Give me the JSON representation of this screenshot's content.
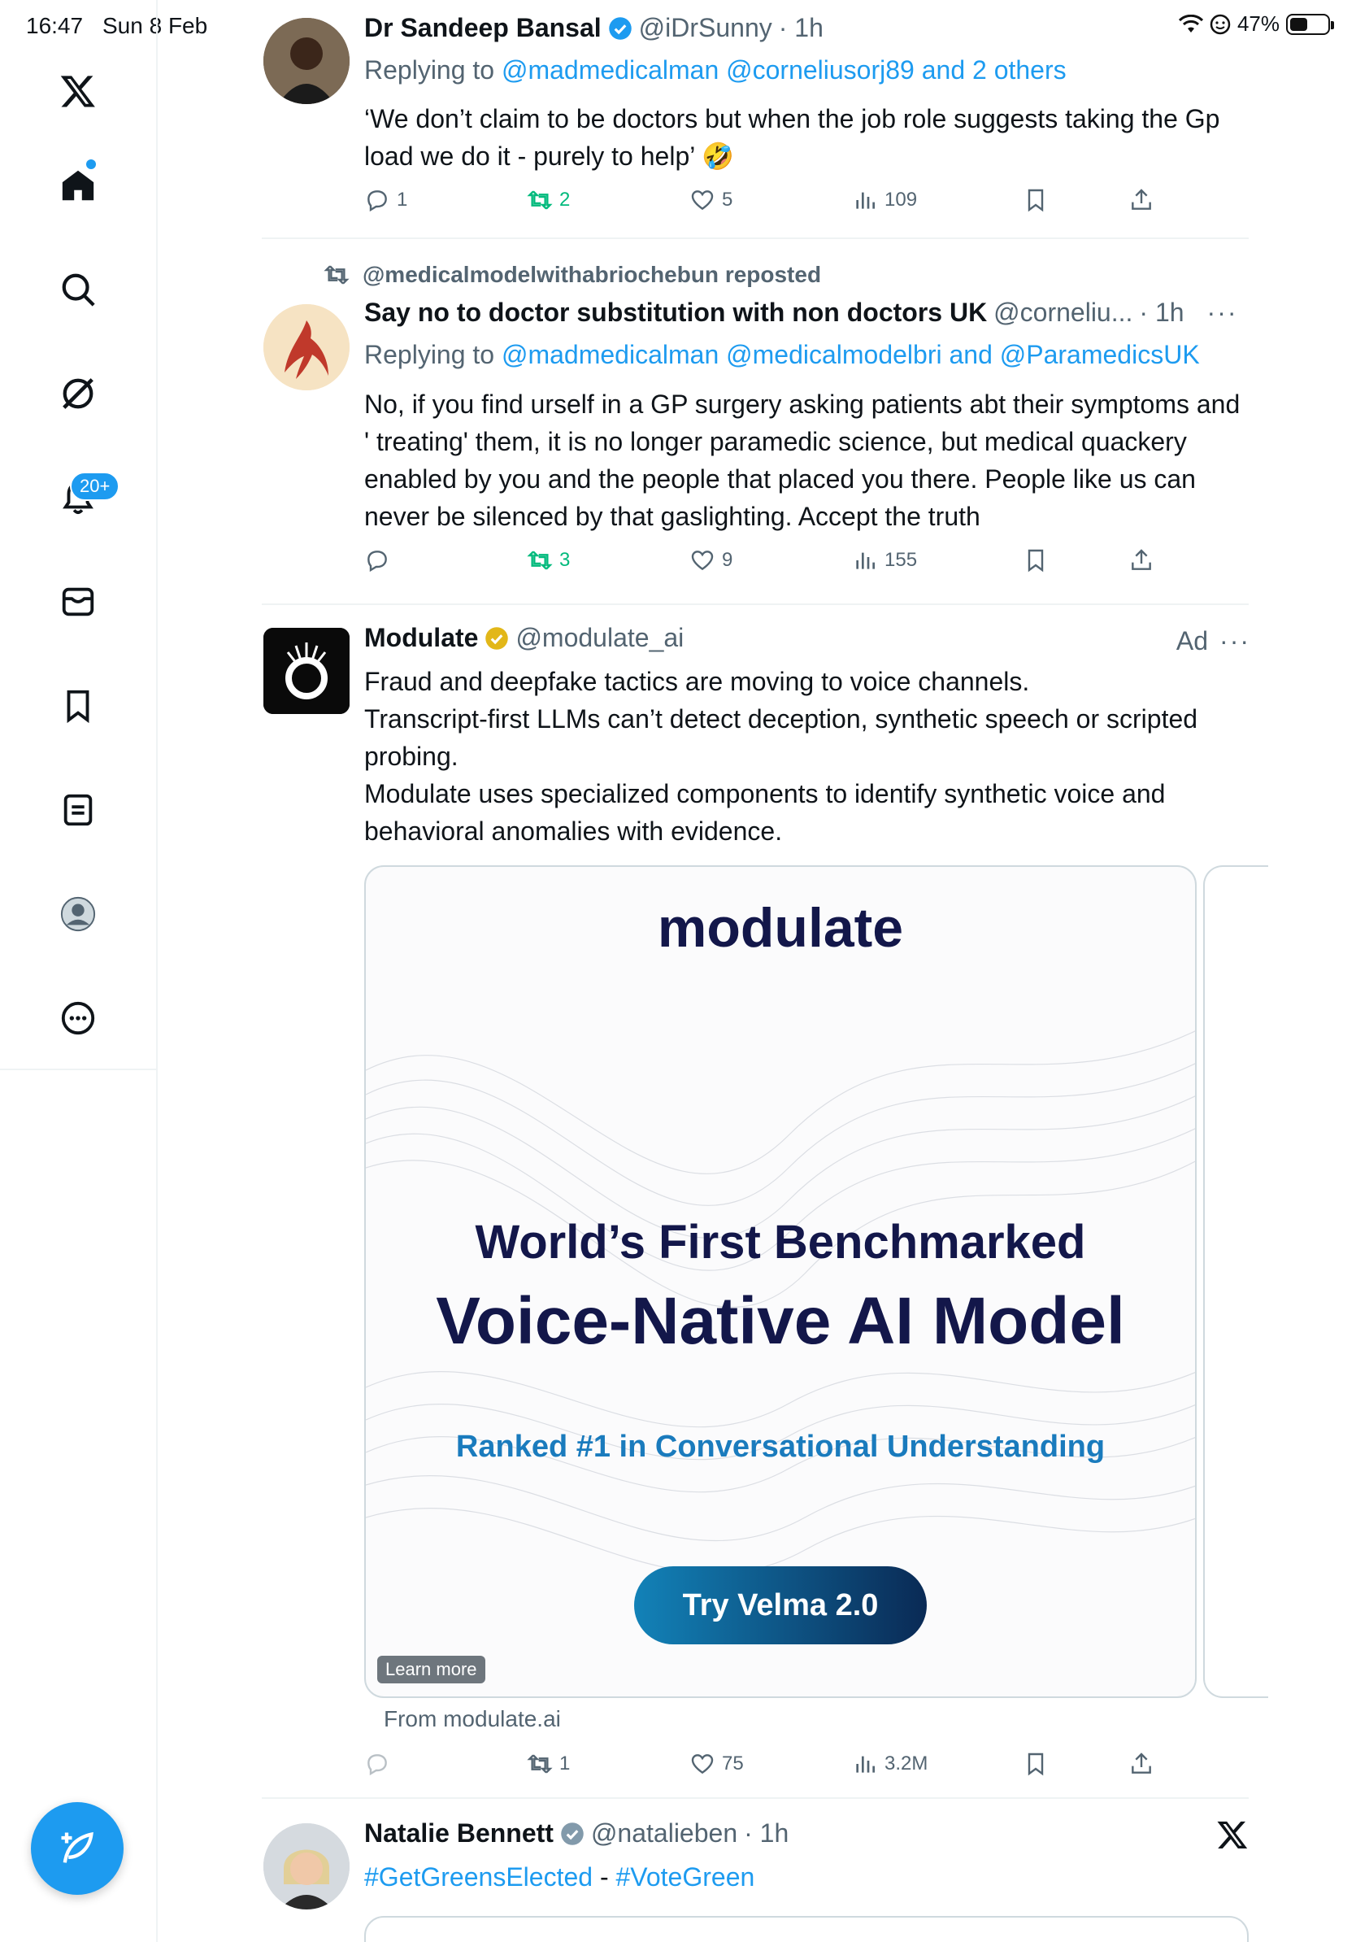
{
  "status_bar": {
    "time": "16:47",
    "date": "Sun 8 Feb",
    "battery": "47%",
    "battery_level": 0.47
  },
  "sidebar": {
    "notifications_badge": "20+",
    "accent": "#1d9bf0"
  },
  "tweets": [
    {
      "name": "Dr Sandeep Bansal",
      "handle": "@iDrSunny",
      "time": "· 1h",
      "replying_prefix": "Replying to",
      "replying_mentions": "@madmedicalman @corneliusorj89 and 2 others",
      "text": "‘We don’t claim to be doctors but when the job role suggests taking the Gp load we do it - purely to help’ 🤣",
      "replies": "1",
      "reposts": "2",
      "likes": "5",
      "views": "109"
    },
    {
      "reposted_by": "@medicalmodelwithabriochebun reposted",
      "name": "Say no to doctor substitution with non doctors UK",
      "handle": "@corneliu...",
      "time": "· 1h",
      "more": "···",
      "replying_prefix": "Replying to",
      "replying_mentions": "@madmedicalman @medicalmodelbri and @ParamedicsUK",
      "text": "No, if you find urself in a GP surgery asking patients abt their symptoms and ' treating' them, it is no longer paramedic science, but medical quackery enabled by you and the people that placed you there. People like us can never be silenced by that gaslighting. Accept the truth",
      "replies": "",
      "reposts": "3",
      "likes": "9",
      "views": "155"
    }
  ],
  "ad": {
    "name": "Modulate",
    "handle": "@modulate_ai",
    "label": "Ad",
    "more": "···",
    "text_lines": [
      "Fraud and deepfake tactics are moving to voice channels.",
      "Transcript-first LLMs can’t detect deception, synthetic speech or scripted probing.",
      "Modulate uses specialized components to identify synthetic voice and behavioral anomalies with evidence."
    ],
    "card": {
      "logo": "modulate",
      "headline": "World’s First Benchmarked",
      "headline2": "Voice-Native AI Model",
      "subheadline": "Ranked #1 in Conversational Understanding",
      "cta": "Try Velma 2.0",
      "learn_more": "Learn more"
    },
    "from": "From modulate.ai",
    "replies": "",
    "reposts": "1",
    "likes": "75",
    "views": "3.2M"
  },
  "tweet3": {
    "name": "Natalie Bennett",
    "handle": "@natalieben",
    "time": "· 1h",
    "hashtag1": "#GetGreensElected",
    "separator": " - ",
    "hashtag2": "#VoteGreen"
  }
}
